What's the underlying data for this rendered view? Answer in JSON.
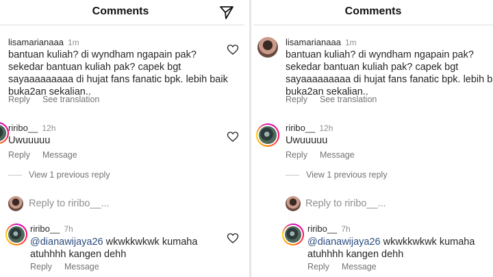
{
  "header": {
    "title": "Comments"
  },
  "comments": [
    {
      "username": "lisamarianaaa",
      "time": "1m",
      "lines": [
        "bantuan kuliah? di wyndham ngapain pak?",
        "sekedar bantuan kuliah pak? capek bgt",
        "sayaaaaaaaaa di hujat fans fanatic bpk. lebih baik",
        "buka2an sekalian.."
      ],
      "actions": [
        "Reply",
        "See translation"
      ]
    },
    {
      "username": "riribo__",
      "time": "12h",
      "lines": [
        "Uwuuuuu"
      ],
      "actions": [
        "Reply",
        "Message"
      ]
    }
  ],
  "view_replies": "View 1 previous reply",
  "reply_input": {
    "placeholder": "Reply to riribo__..."
  },
  "reply": {
    "username": "riribo__",
    "time": "7h",
    "mention": "@dianawijaya26",
    "text_after_mention": " wkwkkwkwk kumaha",
    "line2": "atuhhhh kangen dehh",
    "actions": [
      "Reply",
      "Message"
    ]
  },
  "icons": {
    "send": "send-icon",
    "heart": "heart-icon",
    "avatar_lisa": "avatar",
    "avatar_riribo": "avatar"
  },
  "colors": {
    "mention": "#2b4c7e",
    "muted": "#737373",
    "text": "#262626"
  }
}
